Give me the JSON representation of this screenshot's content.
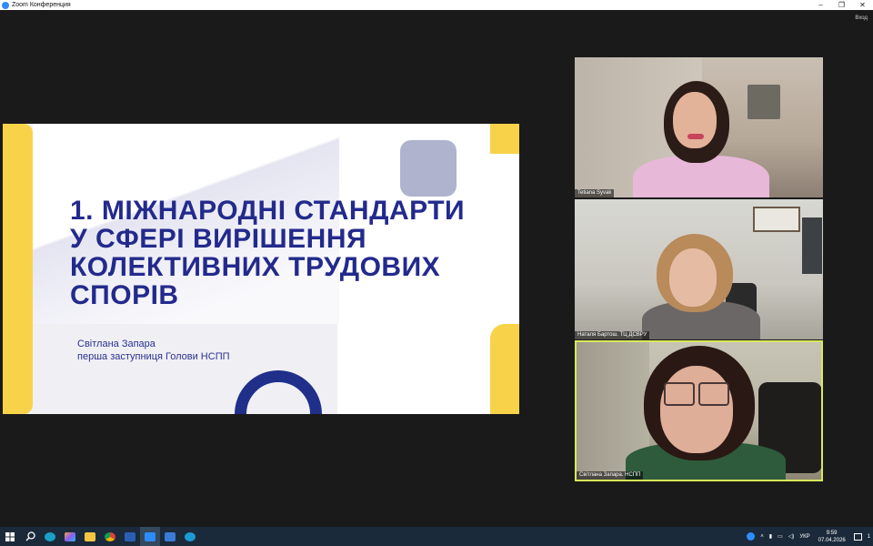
{
  "window": {
    "title": "Zoom Конференция",
    "controls": [
      "–",
      "❐",
      "✕"
    ]
  },
  "stage": {
    "exit_label": "Вход"
  },
  "slide": {
    "title_lines": [
      "1. МІЖНАРОДНІ СТАНДАРТИ",
      "У СФЕРІ ВИРІШЕННЯ",
      "КОЛЕКТИВНИХ ТРУДОВИХ",
      "СПОРІВ"
    ],
    "presenter_name": "Світлана Запара",
    "presenter_role": "перша заступниця Голови НСПП"
  },
  "participants": [
    {
      "name": "Tetiana Syvak"
    },
    {
      "name": "Наталя Бартош. ТЦ ДСВРУ"
    },
    {
      "name": "Світлана Запара. НСПП"
    }
  ],
  "taskbar": {
    "apps": [
      "windows-start",
      "search",
      "edge",
      "copilot",
      "file-explorer",
      "chrome",
      "word",
      "zoom",
      "snipping-tool",
      "app"
    ],
    "tray_lang": "УКР",
    "time": "9:59",
    "date": "07.04.2026",
    "notifications": "1"
  }
}
